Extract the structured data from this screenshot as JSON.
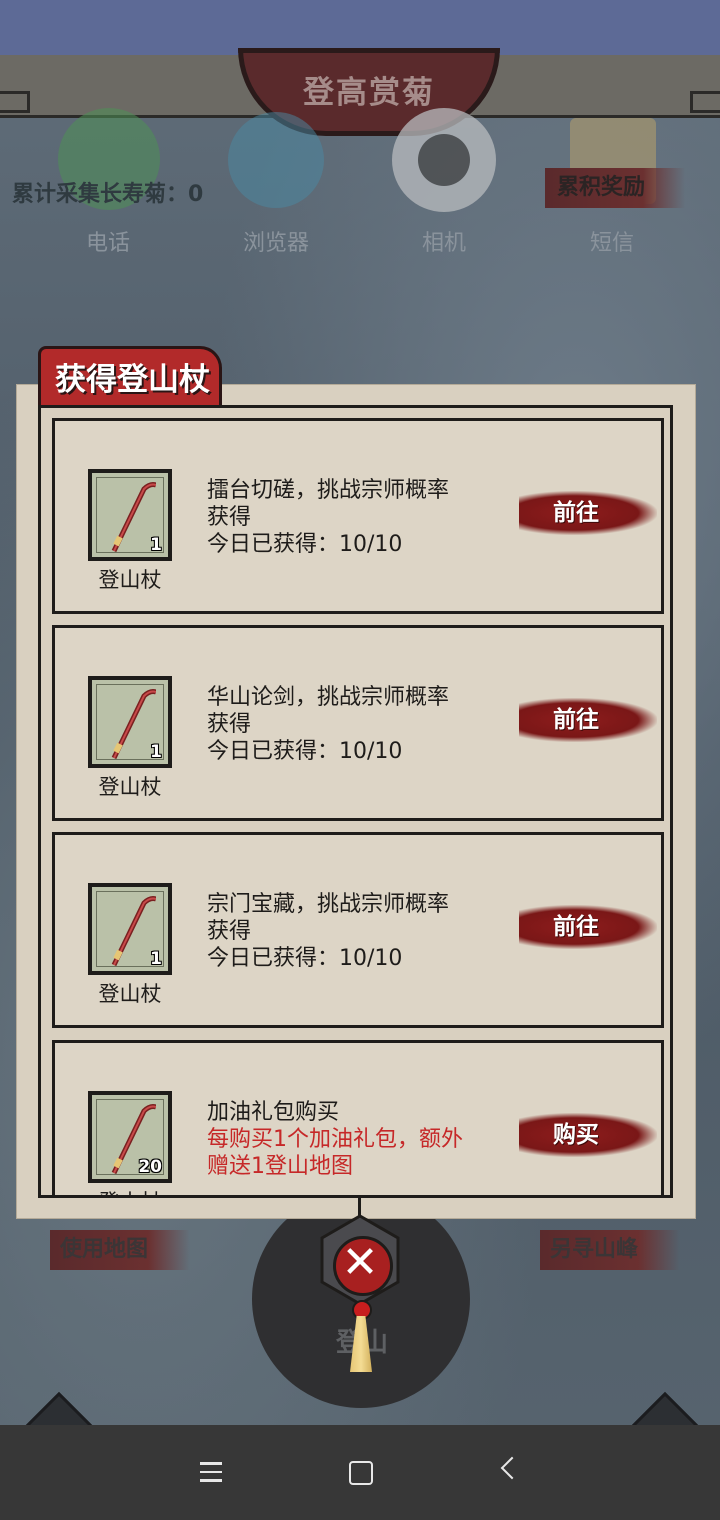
{
  "page": {
    "title": "登高赏菊"
  },
  "phone_apps": [
    {
      "label": "电话",
      "icon": "phone-icon"
    },
    {
      "label": "浏览器",
      "icon": "browser-icon"
    },
    {
      "label": "相机",
      "icon": "camera-icon"
    },
    {
      "label": "短信",
      "icon": "message-icon"
    }
  ],
  "hud": {
    "collect_label": "累计采集长寿菊：0",
    "reward_label": "累积奖励",
    "use_map_label": "使用地图",
    "other_peak_label": "另寻山峰",
    "mountain_label": "登山"
  },
  "dialog": {
    "title": "获得登山杖",
    "items": [
      {
        "item_name": "登山杖",
        "count": "1",
        "desc": "擂台切磋，挑战宗师概率",
        "desc2": "获得",
        "progress": "今日已获得：10/10",
        "button": "前往"
      },
      {
        "item_name": "登山杖",
        "count": "1",
        "desc": "华山论剑，挑战宗师概率",
        "desc2": "获得",
        "progress": "今日已获得：10/10",
        "button": "前往"
      },
      {
        "item_name": "登山杖",
        "count": "1",
        "desc": "宗门宝藏，挑战宗师概率",
        "desc2": "获得",
        "progress": "今日已获得：10/10",
        "button": "前往"
      },
      {
        "item_name": "登山杖",
        "count": "20",
        "desc": "加油礼包购买",
        "desc_red": "每购买1个加油礼包，额外",
        "desc_red2": "赠送1登山地图",
        "button": "购买"
      }
    ]
  },
  "colors": {
    "accent_red": "#b22a2a",
    "paper": "#ddd5c6",
    "ink": "#1e1c1a"
  }
}
